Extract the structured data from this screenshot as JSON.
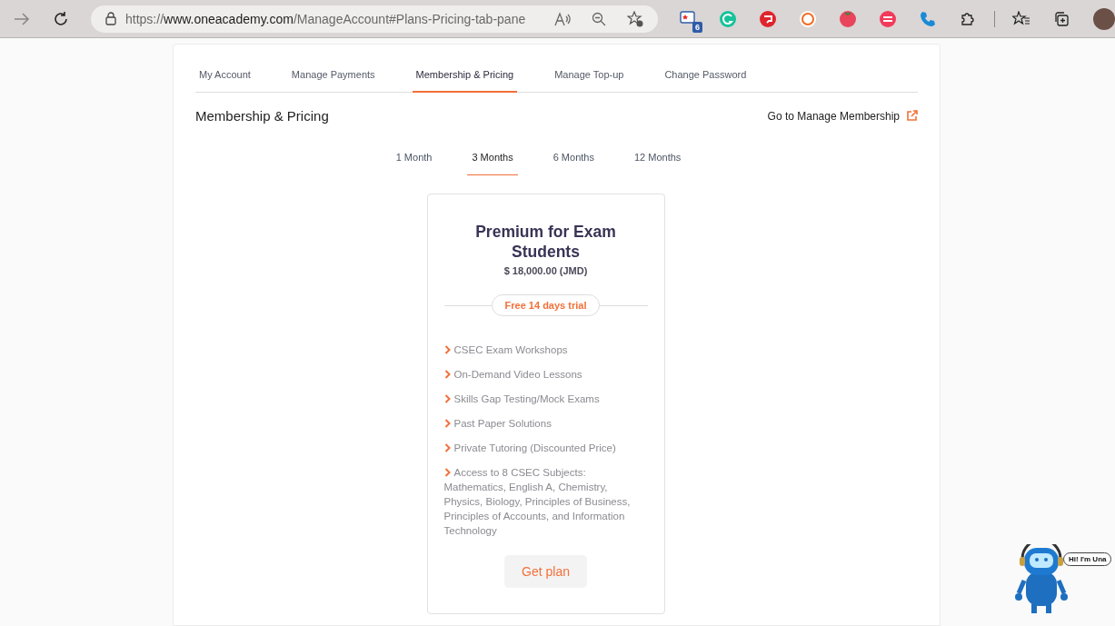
{
  "browser": {
    "url_scheme": "https://",
    "url_domain": "www.oneacademy.com",
    "url_path": "/ManageAccount#Plans-Pricing-tab-pane",
    "extension_badge": "6"
  },
  "account_tabs": [
    {
      "label": "My Account",
      "selected": false
    },
    {
      "label": "Manage Payments",
      "selected": false
    },
    {
      "label": "Membership & Pricing",
      "selected": true
    },
    {
      "label": "Manage Top-up",
      "selected": false
    },
    {
      "label": "Change Password",
      "selected": false
    }
  ],
  "section_title": "Membership & Pricing",
  "manage_link": "Go to Manage Membership",
  "duration_tabs": [
    {
      "label": "1 Month",
      "selected": false
    },
    {
      "label": "3 Months",
      "selected": true
    },
    {
      "label": "6 Months",
      "selected": false
    },
    {
      "label": "12 Months",
      "selected": false
    }
  ],
  "plan": {
    "title": "Premium for Exam Students",
    "price": "$ 18,000.00 (JMD)",
    "trial": "Free 14 days trial",
    "features": [
      "CSEC Exam Workshops",
      "On-Demand Video Lessons",
      "Skills Gap Testing/Mock Exams",
      "Past Paper Solutions",
      "Private Tutoring (Discounted Price)",
      "Access to 8 CSEC Subjects: Mathematics, English A, Chemistry, Physics, Biology, Principles of Business, Principles of Accounts, and Information Technology"
    ],
    "button": "Get plan"
  },
  "chatbot": {
    "greeting": "Hi! I'm Una"
  }
}
